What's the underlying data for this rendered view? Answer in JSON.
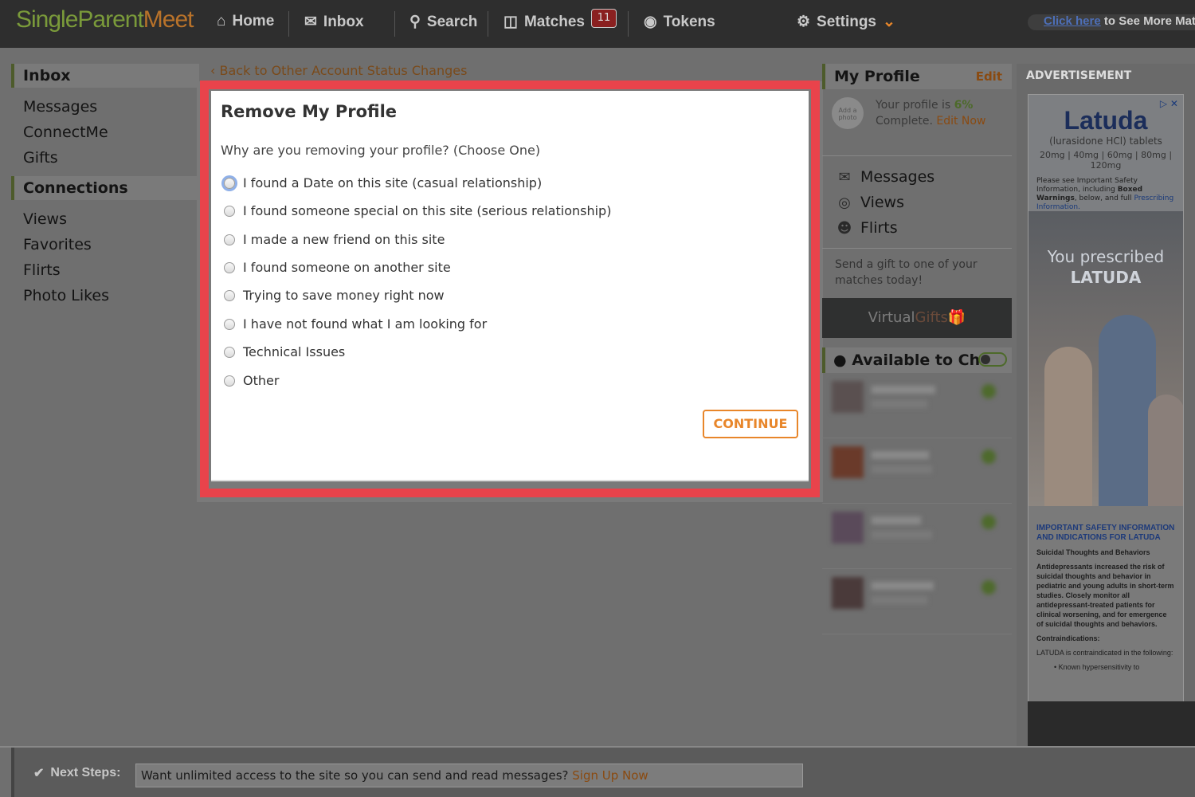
{
  "logo": {
    "part1": "SingleParent",
    "part2": "Meet"
  },
  "nav": {
    "home": "Home",
    "inbox": "Inbox",
    "search": "Search",
    "matches": "Matches",
    "matches_count": "11",
    "tokens": "Tokens",
    "settings": "Settings"
  },
  "promo": {
    "link": "Click here",
    "text": "to See More Mat"
  },
  "sidebar": {
    "inbox_header": "Inbox",
    "inbox_items": [
      "Messages",
      "ConnectMe",
      "Gifts"
    ],
    "connections_header": "Connections",
    "connections_items": [
      "Views",
      "Favorites",
      "Flirts",
      "Photo Likes"
    ]
  },
  "main": {
    "back_link": "Back to Other Account Status Changes",
    "title": "Remove My Profile",
    "question": "Why are you removing your profile? (Choose One)",
    "options": [
      "I found a Date on this site (casual relationship)",
      "I found someone special on this site (serious relationship)",
      "I made a new friend on this site",
      "I found someone on another site",
      "Trying to save money right now",
      "I have not found what I am looking for",
      "Technical Issues",
      "Other"
    ],
    "continue_label": "CONTINUE"
  },
  "profile": {
    "header": "My Profile",
    "edit": "Edit",
    "avatar_text": "Add a photo",
    "complete_prefix": "Your profile is",
    "complete_pct": "6%",
    "complete_suffix": "Complete.",
    "edit_now": "Edit Now",
    "menu": [
      "Messages",
      "Views",
      "Flirts"
    ],
    "gift_text": "Send a gift to one of your matches today!",
    "gift_banner_1": "Virtual",
    "gift_banner_2": "Gifts",
    "chat_header": "Available to Chat"
  },
  "ad": {
    "label": "ADVERTISEMENT",
    "brand": "Latuda",
    "sub": "(lurasidone HCl) tablets",
    "doses": "20mg | 40mg | 60mg | 80mg | 120mg",
    "small_1": "Please see Important Safety Information, including",
    "small_bold": "Boxed Warnings",
    "small_2": ", below, and full",
    "small_link": "Prescribing Information.",
    "tagline_1": "You prescribed",
    "tagline_2": "LATUDA",
    "info_heading": "IMPORTANT SAFETY INFORMATION AND INDICATIONS FOR LATUDA",
    "info_sub": "Suicidal Thoughts and Behaviors",
    "info_body": "Antidepressants increased the risk of suicidal thoughts and behavior in pediatric and young adults in short-term studies. Closely monitor all antidepressant-treated patients for clinical worsening, and for emergence of suicidal thoughts and behaviors.",
    "contra_head": "Contraindications:",
    "contra_body": "LATUDA is contraindicated in the following:",
    "contra_item": "Known hypersensitivity to"
  },
  "bottom": {
    "label": "Next Steps:",
    "text": "Want unlimited access to the site so you can send and read messages?",
    "link": "Sign Up Now"
  },
  "colors": {
    "accent_orange": "#e8862a",
    "highlight_red": "#e9434b",
    "logo_green": "#7a9a3a"
  }
}
